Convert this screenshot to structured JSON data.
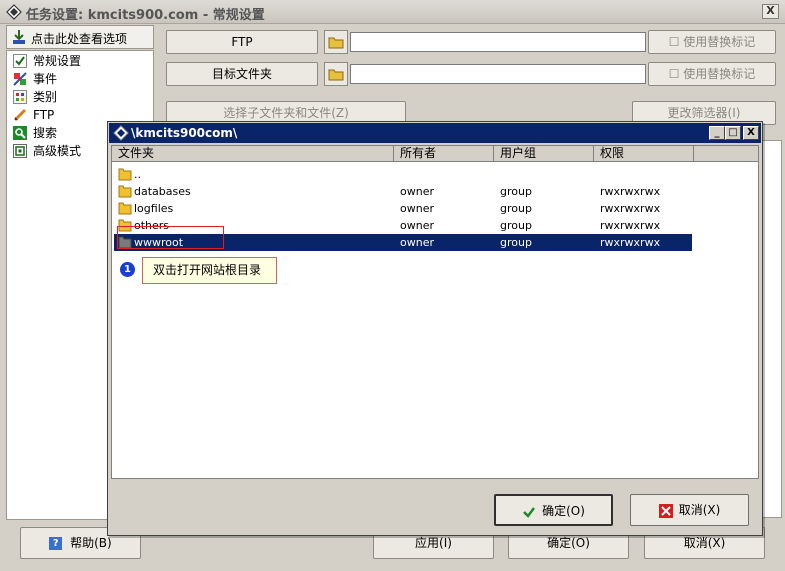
{
  "main_window": {
    "title": "任务设置: kmcits900.com - 常规设置",
    "close_label": "X"
  },
  "sidebar": {
    "header_label": "点击此处查看选项",
    "items": [
      {
        "label": "常规设置",
        "icon": "checklist-icon"
      },
      {
        "label": "事件",
        "icon": "event-icon"
      },
      {
        "label": "类别",
        "icon": "category-icon"
      },
      {
        "label": "FTP",
        "icon": "ftp-icon"
      },
      {
        "label": "搜索",
        "icon": "search-icon"
      },
      {
        "label": "高级模式",
        "icon": "advanced-mode-icon"
      }
    ]
  },
  "main_panel": {
    "ftp_button": "FTP",
    "target_folder_button": "目标文件夹",
    "use_replace_mark_1": "使用替换标记",
    "use_replace_mark_2": "使用替换标记",
    "select_subfolders_button": "选择子文件夹和文件(Z)",
    "change_filter_button": "更改筛选器(I)",
    "ftp_path_value": "",
    "target_path_value": ""
  },
  "main_footer": {
    "help_button": "帮助(B)",
    "apply_button": "应用(I)",
    "ok_button": "确定(O)",
    "cancel_button": "取消(X)"
  },
  "dialog": {
    "title": "\\kmcits900com\\",
    "minimize_label": "_",
    "maximize_label": "□",
    "close_label": "X",
    "columns": [
      "文件夹",
      "所有者",
      "用户组",
      "权限"
    ],
    "rows": [
      {
        "name": "..",
        "owner": "",
        "group": "",
        "perm": "",
        "selected": false
      },
      {
        "name": "databases",
        "owner": "owner",
        "group": "group",
        "perm": "rwxrwxrwx",
        "selected": false
      },
      {
        "name": "logfiles",
        "owner": "owner",
        "group": "group",
        "perm": "rwxrwxrwx",
        "selected": false
      },
      {
        "name": "others",
        "owner": "owner",
        "group": "group",
        "perm": "rwxrwxrwx",
        "selected": false
      },
      {
        "name": "wwwroot",
        "owner": "owner",
        "group": "group",
        "perm": "rwxrwxrwx",
        "selected": true
      }
    ],
    "annotation_number": "1",
    "annotation_text": "双击打开网站根目录",
    "ok_button": "确定(O)",
    "cancel_button": "取消(X)"
  },
  "colors": {
    "titlebar_active": "#0a246a",
    "selection": "#0a246a",
    "tooltip_bg": "#ffffe1",
    "annotation_badge": "#1a3fd0",
    "highlight_border": "#e02020"
  }
}
